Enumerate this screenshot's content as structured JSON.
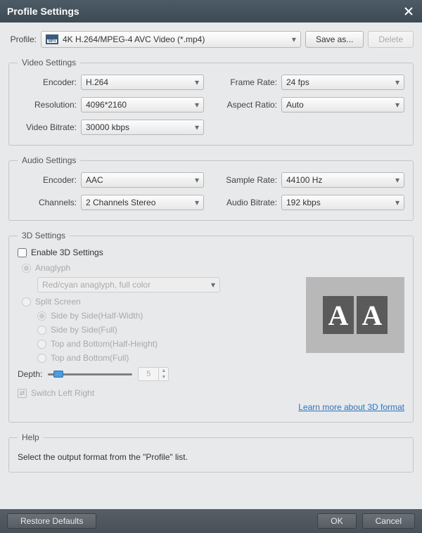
{
  "title": "Profile Settings",
  "profile": {
    "label": "Profile:",
    "value": "4K H.264/MPEG-4 AVC Video (*.mp4)",
    "saveas_label": "Save as...",
    "delete_label": "Delete"
  },
  "video": {
    "legend": "Video Settings",
    "encoder_label": "Encoder:",
    "encoder": "H.264",
    "framerate_label": "Frame Rate:",
    "framerate": "24 fps",
    "resolution_label": "Resolution:",
    "resolution": "4096*2160",
    "aspect_label": "Aspect Ratio:",
    "aspect": "Auto",
    "vbitrate_label": "Video Bitrate:",
    "vbitrate": "30000 kbps"
  },
  "audio": {
    "legend": "Audio Settings",
    "encoder_label": "Encoder:",
    "encoder": "AAC",
    "samplerate_label": "Sample Rate:",
    "samplerate": "44100 Hz",
    "channels_label": "Channels:",
    "channels": "2 Channels Stereo",
    "abitrate_label": "Audio Bitrate:",
    "abitrate": "192 kbps"
  },
  "three_d": {
    "legend": "3D Settings",
    "enable_label": "Enable 3D Settings",
    "anaglyph_label": "Anaglyph",
    "anaglyph_mode": "Red/cyan anaglyph, full color",
    "split_label": "Split Screen",
    "sbs_half": "Side by Side(Half-Width)",
    "sbs_full": "Side by Side(Full)",
    "tb_half": "Top and Bottom(Half-Height)",
    "tb_full": "Top and Bottom(Full)",
    "depth_label": "Depth:",
    "depth_value": "5",
    "switch_label": "Switch Left Right",
    "learnmore": "Learn more about 3D format"
  },
  "help": {
    "legend": "Help",
    "text": "Select the output format from the \"Profile\" list."
  },
  "footer": {
    "restore": "Restore Defaults",
    "ok": "OK",
    "cancel": "Cancel"
  }
}
